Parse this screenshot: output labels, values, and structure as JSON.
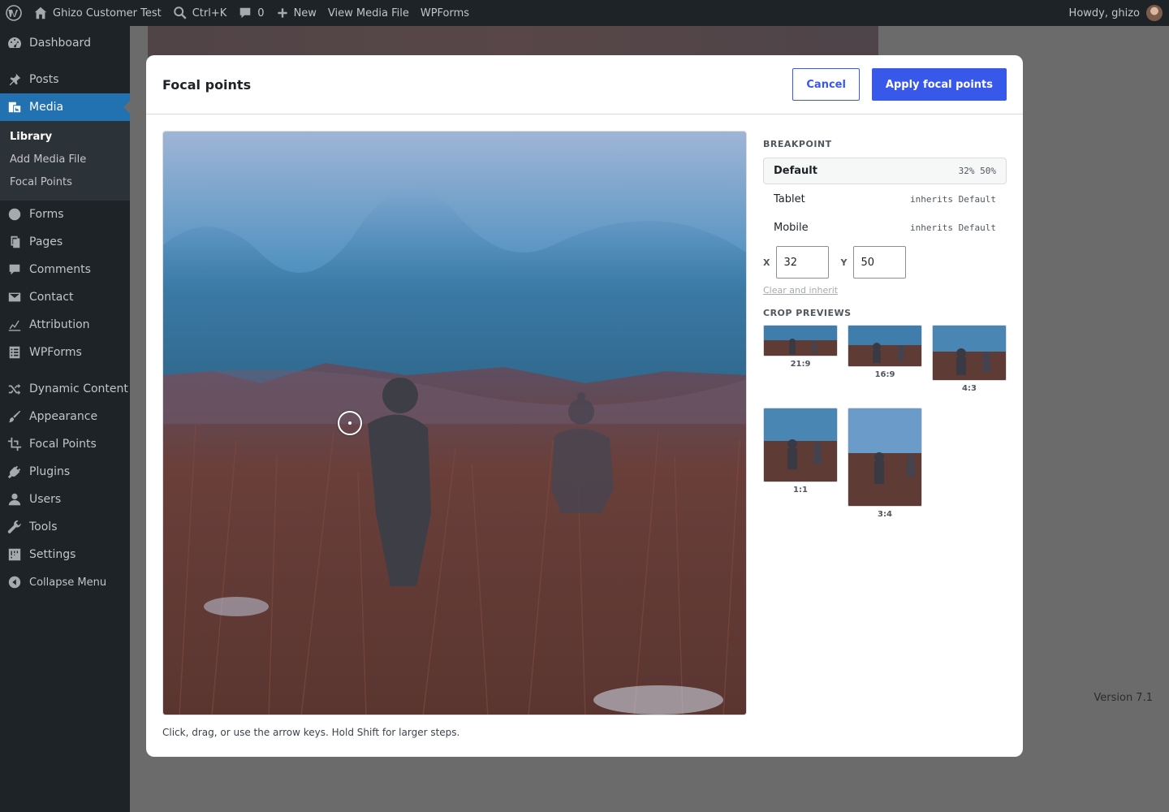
{
  "adminbar": {
    "site_name": "Ghizo Customer Test",
    "search_shortcut": "Ctrl+K",
    "comments_count": "0",
    "new_label": "New",
    "view_media": "View Media File",
    "wpforms": "WPForms",
    "howdy": "Howdy, ghizo"
  },
  "sidebar": {
    "dashboard": "Dashboard",
    "posts": "Posts",
    "media": "Media",
    "media_sub": {
      "library": "Library",
      "add": "Add Media File",
      "focal": "Focal Points"
    },
    "forms": "Forms",
    "pages": "Pages",
    "comments": "Comments",
    "contact": "Contact",
    "attribution": "Attribution",
    "wpforms": "WPForms",
    "dynamic_content": "Dynamic Content",
    "appearance": "Appearance",
    "focal_points": "Focal Points",
    "plugins": "Plugins",
    "users": "Users",
    "tools": "Tools",
    "settings": "Settings",
    "collapse": "Collapse Menu"
  },
  "footer": {
    "version": "Version 7.1"
  },
  "modal": {
    "title": "Focal points",
    "cancel": "Cancel",
    "apply": "Apply focal points",
    "hint": "Click, drag, or use the arrow keys. Hold Shift for larger steps.",
    "focal": {
      "x_percent": 32,
      "y_percent": 50
    },
    "breakpoint_label": "BREAKPOINT",
    "breakpoints": [
      {
        "name": "Default",
        "value": "32% 50%"
      },
      {
        "name": "Tablet",
        "value": "inherits Default"
      },
      {
        "name": "Mobile",
        "value": "inherits Default"
      }
    ],
    "x_label": "X",
    "y_label": "Y",
    "x_value": "32",
    "y_value": "50",
    "clear": "Clear and inherit",
    "crop_label": "CROP PREVIEWS",
    "crops": [
      {
        "label": "21:9"
      },
      {
        "label": "16:9"
      },
      {
        "label": "4:3"
      },
      {
        "label": "1:1"
      },
      {
        "label": "3:4"
      }
    ]
  }
}
